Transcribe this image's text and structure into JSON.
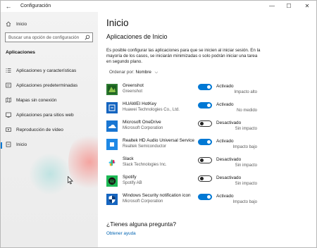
{
  "window": {
    "title": "Configuración",
    "back_glyph": "←",
    "minimize_glyph": "—",
    "maximize_glyph": "☐",
    "close_glyph": "✕"
  },
  "sidebar": {
    "home_label": "Inicio",
    "search_placeholder": "Buscar una opción de configuración",
    "section_label": "Aplicaciones",
    "items": [
      {
        "label": "Aplicaciones y características",
        "icon": "list-icon",
        "active": false
      },
      {
        "label": "Aplicaciones predeterminadas",
        "icon": "default-apps-icon",
        "active": false
      },
      {
        "label": "Mapas sin conexión",
        "icon": "map-icon",
        "active": false
      },
      {
        "label": "Aplicaciones para sitios web",
        "icon": "website-apps-icon",
        "active": false
      },
      {
        "label": "Reproducción de vídeo",
        "icon": "video-icon",
        "active": false
      },
      {
        "label": "Inicio",
        "icon": "startup-icon",
        "active": true
      }
    ]
  },
  "main": {
    "page_title": "Inicio",
    "section_title": "Aplicaciones de Inicio",
    "description": "Es posible configurar las aplicaciones para que se inicien al iniciar sesión. En la mayoría de los casos, se iniciarán minimizadas o solo podrán iniciar una tarea en segundo plano.",
    "sort_label": "Ordenar por:",
    "sort_value": "Nombre",
    "apps": [
      {
        "name": "Greenshot",
        "publisher": "Greenshot",
        "state": "Activado",
        "on": true,
        "impact": "Impacto alto",
        "icon": "greenshot-icon"
      },
      {
        "name": "HUAWEI HotKey",
        "publisher": "Huawei Technologies Co., Ltd.",
        "state": "Activado",
        "on": true,
        "impact": "No medido",
        "icon": "huawei-hotkey-icon"
      },
      {
        "name": "Microsoft OneDrive",
        "publisher": "Microsoft Corporation",
        "state": "Desactivado",
        "on": false,
        "impact": "Sin impacto",
        "icon": "onedrive-icon"
      },
      {
        "name": "Realtek HD Audio Universal Service",
        "publisher": "Realtek Semiconductor",
        "state": "Activado",
        "on": true,
        "impact": "Impacto bajo",
        "icon": "realtek-icon"
      },
      {
        "name": "Slack",
        "publisher": "Slack Technologies Inc.",
        "state": "Desactivado",
        "on": false,
        "impact": "Sin impacto",
        "icon": "slack-icon"
      },
      {
        "name": "Spotify",
        "publisher": "Spotify AB",
        "state": "Desactivado",
        "on": false,
        "impact": "Sin impacto",
        "icon": "spotify-icon"
      },
      {
        "name": "Windows Security notification icon",
        "publisher": "Microsoft Corporation",
        "state": "Activado",
        "on": true,
        "impact": "Impacto bajo",
        "icon": "windows-security-icon"
      }
    ],
    "question": "¿Tienes alguna pregunta?",
    "help_link": "Obtener ayuda"
  },
  "colors": {
    "accent": "#0078d4",
    "link": "#0063b1",
    "greenshot": "#2e7d32",
    "huawei": "#1565c0",
    "onedrive": "#1976d2",
    "realtek": "#1e88e5",
    "spotify": "#1db954",
    "windows_security": "#1565c0"
  }
}
